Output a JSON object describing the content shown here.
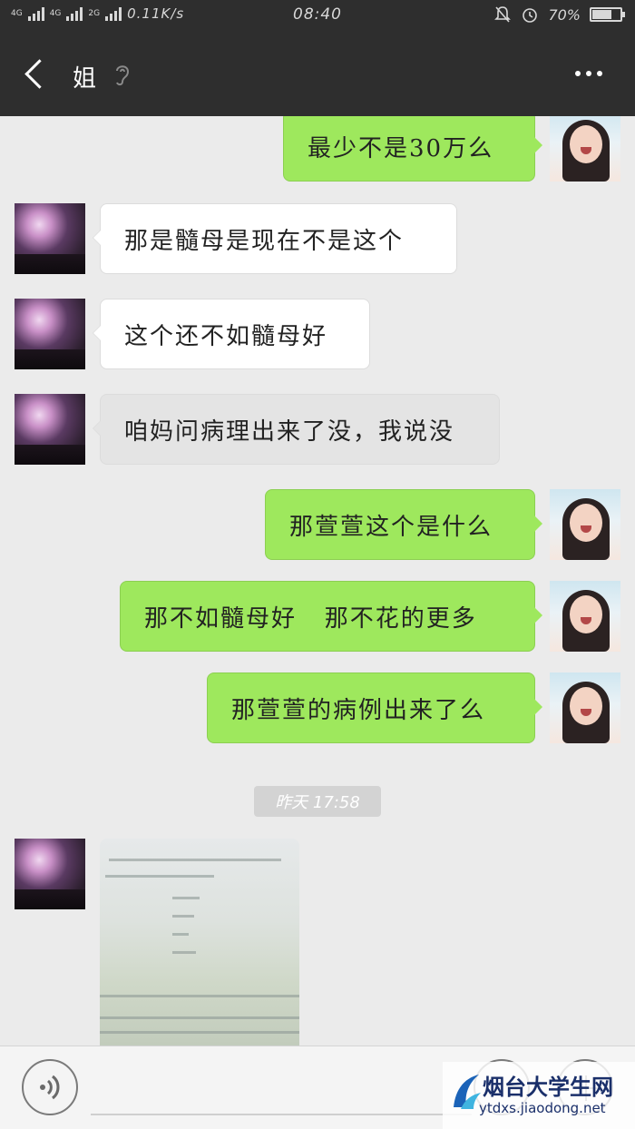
{
  "status_bar": {
    "network_left": "4G",
    "network_mid": "4G",
    "network_right": "2G",
    "speed": "0.11K/s",
    "time": "08:40",
    "battery": "70%",
    "battery_level": 0.7
  },
  "header": {
    "contact_name": "姐"
  },
  "messages": [
    {
      "side": "out",
      "text": "最少不是30万么"
    },
    {
      "side": "in",
      "text": "那是髓母是现在不是这个"
    },
    {
      "side": "in",
      "text": "这个还不如髓母好"
    },
    {
      "side": "in",
      "text": "咱妈问病理出来了没，我说没"
    },
    {
      "side": "out",
      "text": "那萱萱这个是什么"
    },
    {
      "side": "out",
      "text": "那不如髓母好   那不花的更多"
    },
    {
      "side": "out",
      "text": "那萱萱的病例出来了么"
    }
  ],
  "timestamp": "昨天 17:58",
  "watermark": {
    "title": "烟台大学生网",
    "url": "ytdxs.jiaodong.net"
  }
}
